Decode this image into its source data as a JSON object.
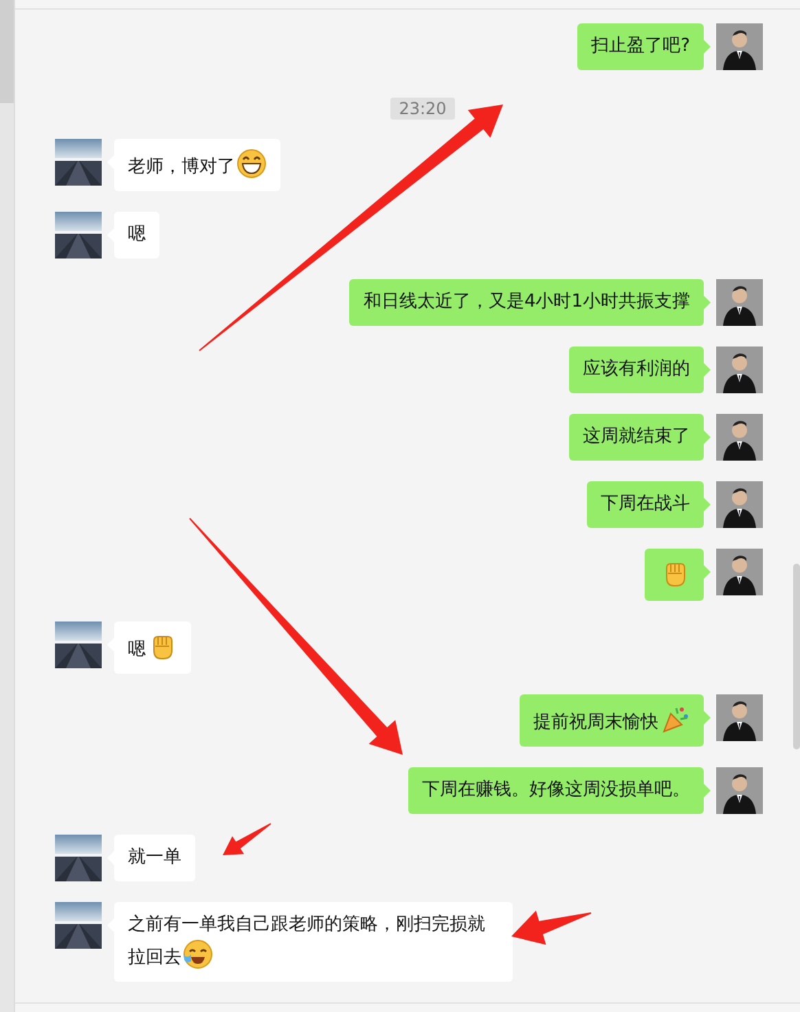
{
  "messages": [
    {
      "kind": "sent",
      "parts": [
        {
          "kind": "text",
          "text": "扫止盈了吧?"
        }
      ]
    },
    {
      "kind": "time",
      "text": "23:20"
    },
    {
      "kind": "received",
      "parts": [
        {
          "kind": "text",
          "text": "老师，博对了"
        },
        {
          "kind": "grin"
        }
      ]
    },
    {
      "kind": "received",
      "parts": [
        {
          "kind": "text",
          "text": "嗯"
        }
      ]
    },
    {
      "kind": "sent",
      "parts": [
        {
          "kind": "text",
          "text": "和日线太近了，又是4小时1小时共振支撑"
        }
      ]
    },
    {
      "kind": "sent",
      "parts": [
        {
          "kind": "text",
          "text": "应该有利润的"
        }
      ]
    },
    {
      "kind": "sent",
      "parts": [
        {
          "kind": "text",
          "text": "这周就结束了"
        }
      ]
    },
    {
      "kind": "sent",
      "parts": [
        {
          "kind": "text",
          "text": "下周在战斗"
        }
      ]
    },
    {
      "kind": "sent",
      "parts": [
        {
          "kind": "fist"
        }
      ]
    },
    {
      "kind": "received",
      "parts": [
        {
          "kind": "text",
          "text": "嗯"
        },
        {
          "kind": "fist"
        }
      ]
    },
    {
      "kind": "sent",
      "parts": [
        {
          "kind": "text",
          "text": "提前祝周末愉快"
        },
        {
          "kind": "party"
        }
      ]
    },
    {
      "kind": "sent",
      "parts": [
        {
          "kind": "text",
          "text": "下周在赚钱。好像这周没损单吧。"
        }
      ]
    },
    {
      "kind": "received",
      "parts": [
        {
          "kind": "text",
          "text": "就一单"
        }
      ]
    },
    {
      "kind": "received",
      "parts": [
        {
          "kind": "text",
          "text": "之前有一单我自己跟老师的策略，刚扫完损就拉回去"
        },
        {
          "kind": "laugh"
        }
      ]
    }
  ]
}
